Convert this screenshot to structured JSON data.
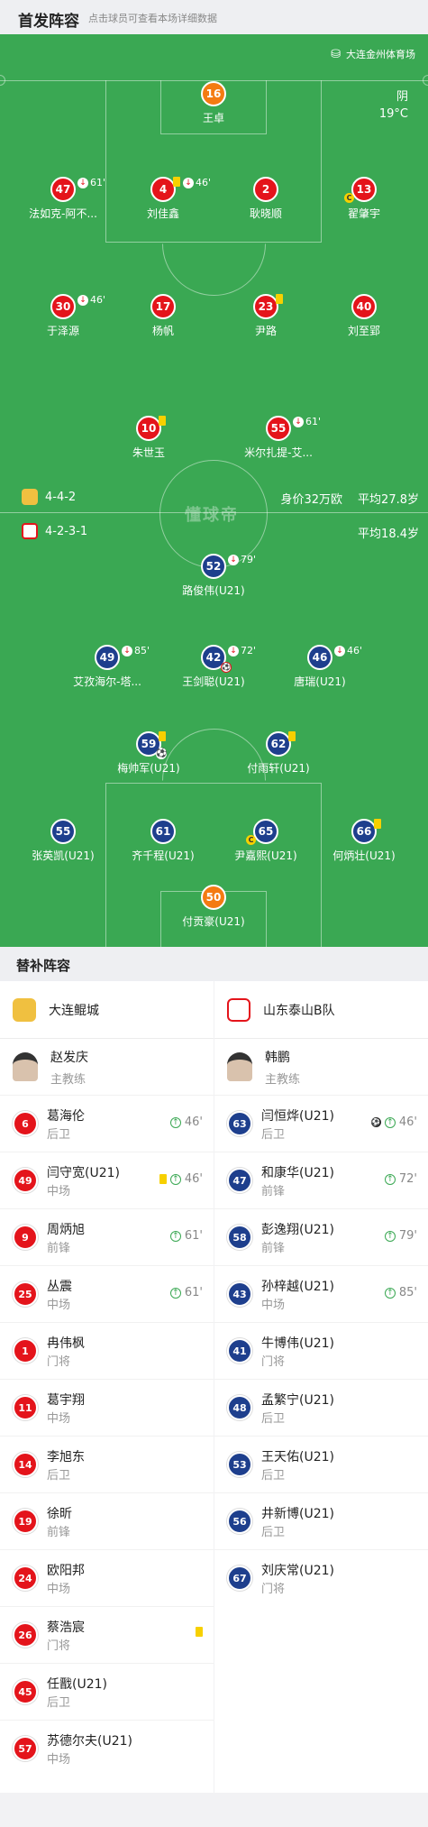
{
  "header": {
    "title": "首发阵容",
    "subtitle": "点击球员可查看本场详细数据"
  },
  "match": {
    "stadium": "大连金州体育场",
    "weather": "阴",
    "temperature": "19°C",
    "watermark": "懂球帝"
  },
  "home": {
    "formation": "4-4-2",
    "value": "身价32万欧",
    "avg_age": "平均27.8岁"
  },
  "away": {
    "formation": "4-2-3-1",
    "avg_age": "平均18.4岁"
  },
  "home_players": [
    {
      "num": "16",
      "name": "王卓"
    },
    {
      "num": "47",
      "name": "法如克-阿不...",
      "sub": "61'"
    },
    {
      "num": "4",
      "name": "刘佳鑫",
      "sub": "46'"
    },
    {
      "num": "2",
      "name": "耿晓顺"
    },
    {
      "num": "13",
      "name": "翟肇宇",
      "cap": "C"
    },
    {
      "num": "30",
      "name": "于泽源",
      "sub": "46'"
    },
    {
      "num": "17",
      "name": "杨帆"
    },
    {
      "num": "23",
      "name": "尹路"
    },
    {
      "num": "40",
      "name": "刘至郢"
    },
    {
      "num": "10",
      "name": "朱世玉"
    },
    {
      "num": "55",
      "name": "米尔扎提-艾...",
      "sub": "61'"
    }
  ],
  "away_players": [
    {
      "num": "52",
      "name": "路俊伟(U21)",
      "sub": "79'"
    },
    {
      "num": "49",
      "name": "艾孜海尔-塔...",
      "sub": "85'"
    },
    {
      "num": "42",
      "name": "王剑聪(U21)",
      "sub": "72'"
    },
    {
      "num": "46",
      "name": "唐瑞(U21)",
      "sub": "46'"
    },
    {
      "num": "59",
      "name": "梅帅军(U21)"
    },
    {
      "num": "62",
      "name": "付雨轩(U21)"
    },
    {
      "num": "55",
      "name": "张英凯(U21)"
    },
    {
      "num": "61",
      "name": "齐千程(U21)"
    },
    {
      "num": "65",
      "name": "尹嘉熙(U21)",
      "cap": "C"
    },
    {
      "num": "66",
      "name": "何炳壮(U21)"
    },
    {
      "num": "50",
      "name": "付贡豪(U21)"
    }
  ],
  "subs_title": "替补阵容",
  "home_bench": {
    "team": "大连鲲城",
    "coach": {
      "name": "赵发庆",
      "role": "主教练"
    },
    "players": [
      {
        "num": "6",
        "name": "葛海伦",
        "pos": "后卫",
        "min": "46'"
      },
      {
        "num": "49",
        "name": "闫守宽(U21)",
        "pos": "中场",
        "min": "46'"
      },
      {
        "num": "9",
        "name": "周炳旭",
        "pos": "前锋",
        "min": "61'"
      },
      {
        "num": "25",
        "name": "丛震",
        "pos": "中场",
        "min": "61'"
      },
      {
        "num": "1",
        "name": "冉伟枫",
        "pos": "门将"
      },
      {
        "num": "11",
        "name": "葛宇翔",
        "pos": "中场"
      },
      {
        "num": "14",
        "name": "李旭东",
        "pos": "后卫"
      },
      {
        "num": "19",
        "name": "徐昕",
        "pos": "前锋"
      },
      {
        "num": "24",
        "name": "欧阳邦",
        "pos": "中场"
      },
      {
        "num": "26",
        "name": "蔡浩宸",
        "pos": "门将"
      },
      {
        "num": "45",
        "name": "任戬(U21)",
        "pos": "后卫"
      },
      {
        "num": "57",
        "name": "苏德尔夫(U21)",
        "pos": "中场"
      }
    ]
  },
  "away_bench": {
    "team": "山东泰山B队",
    "coach": {
      "name": "韩鹏",
      "role": "主教练"
    },
    "players": [
      {
        "num": "63",
        "name": "闫恒烨(U21)",
        "pos": "后卫",
        "min": "46'"
      },
      {
        "num": "47",
        "name": "和康华(U21)",
        "pos": "前锋",
        "min": "72'"
      },
      {
        "num": "58",
        "name": "彭逸翔(U21)",
        "pos": "前锋",
        "min": "79'"
      },
      {
        "num": "43",
        "name": "孙梓越(U21)",
        "pos": "中场",
        "min": "85'"
      },
      {
        "num": "41",
        "name": "牛博伟(U21)",
        "pos": "门将"
      },
      {
        "num": "48",
        "name": "孟繁宁(U21)",
        "pos": "后卫"
      },
      {
        "num": "53",
        "name": "王天佑(U21)",
        "pos": "后卫"
      },
      {
        "num": "56",
        "name": "井新博(U21)",
        "pos": "后卫"
      },
      {
        "num": "67",
        "name": "刘庆常(U21)",
        "pos": "门将"
      }
    ]
  }
}
